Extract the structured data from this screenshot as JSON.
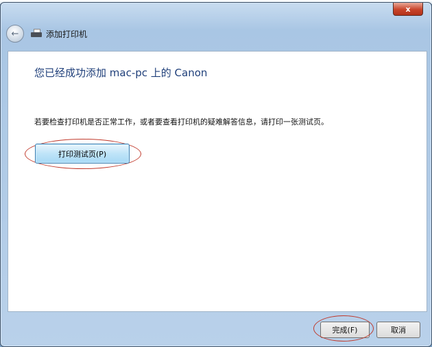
{
  "window": {
    "title": "添加打印机",
    "close_symbol": "x"
  },
  "main": {
    "heading": "您已经成功添加 mac-pc 上的 Canon",
    "description": "若要检查打印机是否正常工作，或者要查看打印机的疑难解答信息，请打印一张测试页。",
    "print_test_button": "打印测试页(P)"
  },
  "footer": {
    "finish_button": "完成(F)",
    "cancel_button": "取消"
  },
  "icons": {
    "back": "back-arrow-icon",
    "printer": "printer-icon"
  },
  "colors": {
    "heading": "#1f3f7a",
    "annotation": "#c0392b",
    "primary_button": "#bfe4f8"
  }
}
